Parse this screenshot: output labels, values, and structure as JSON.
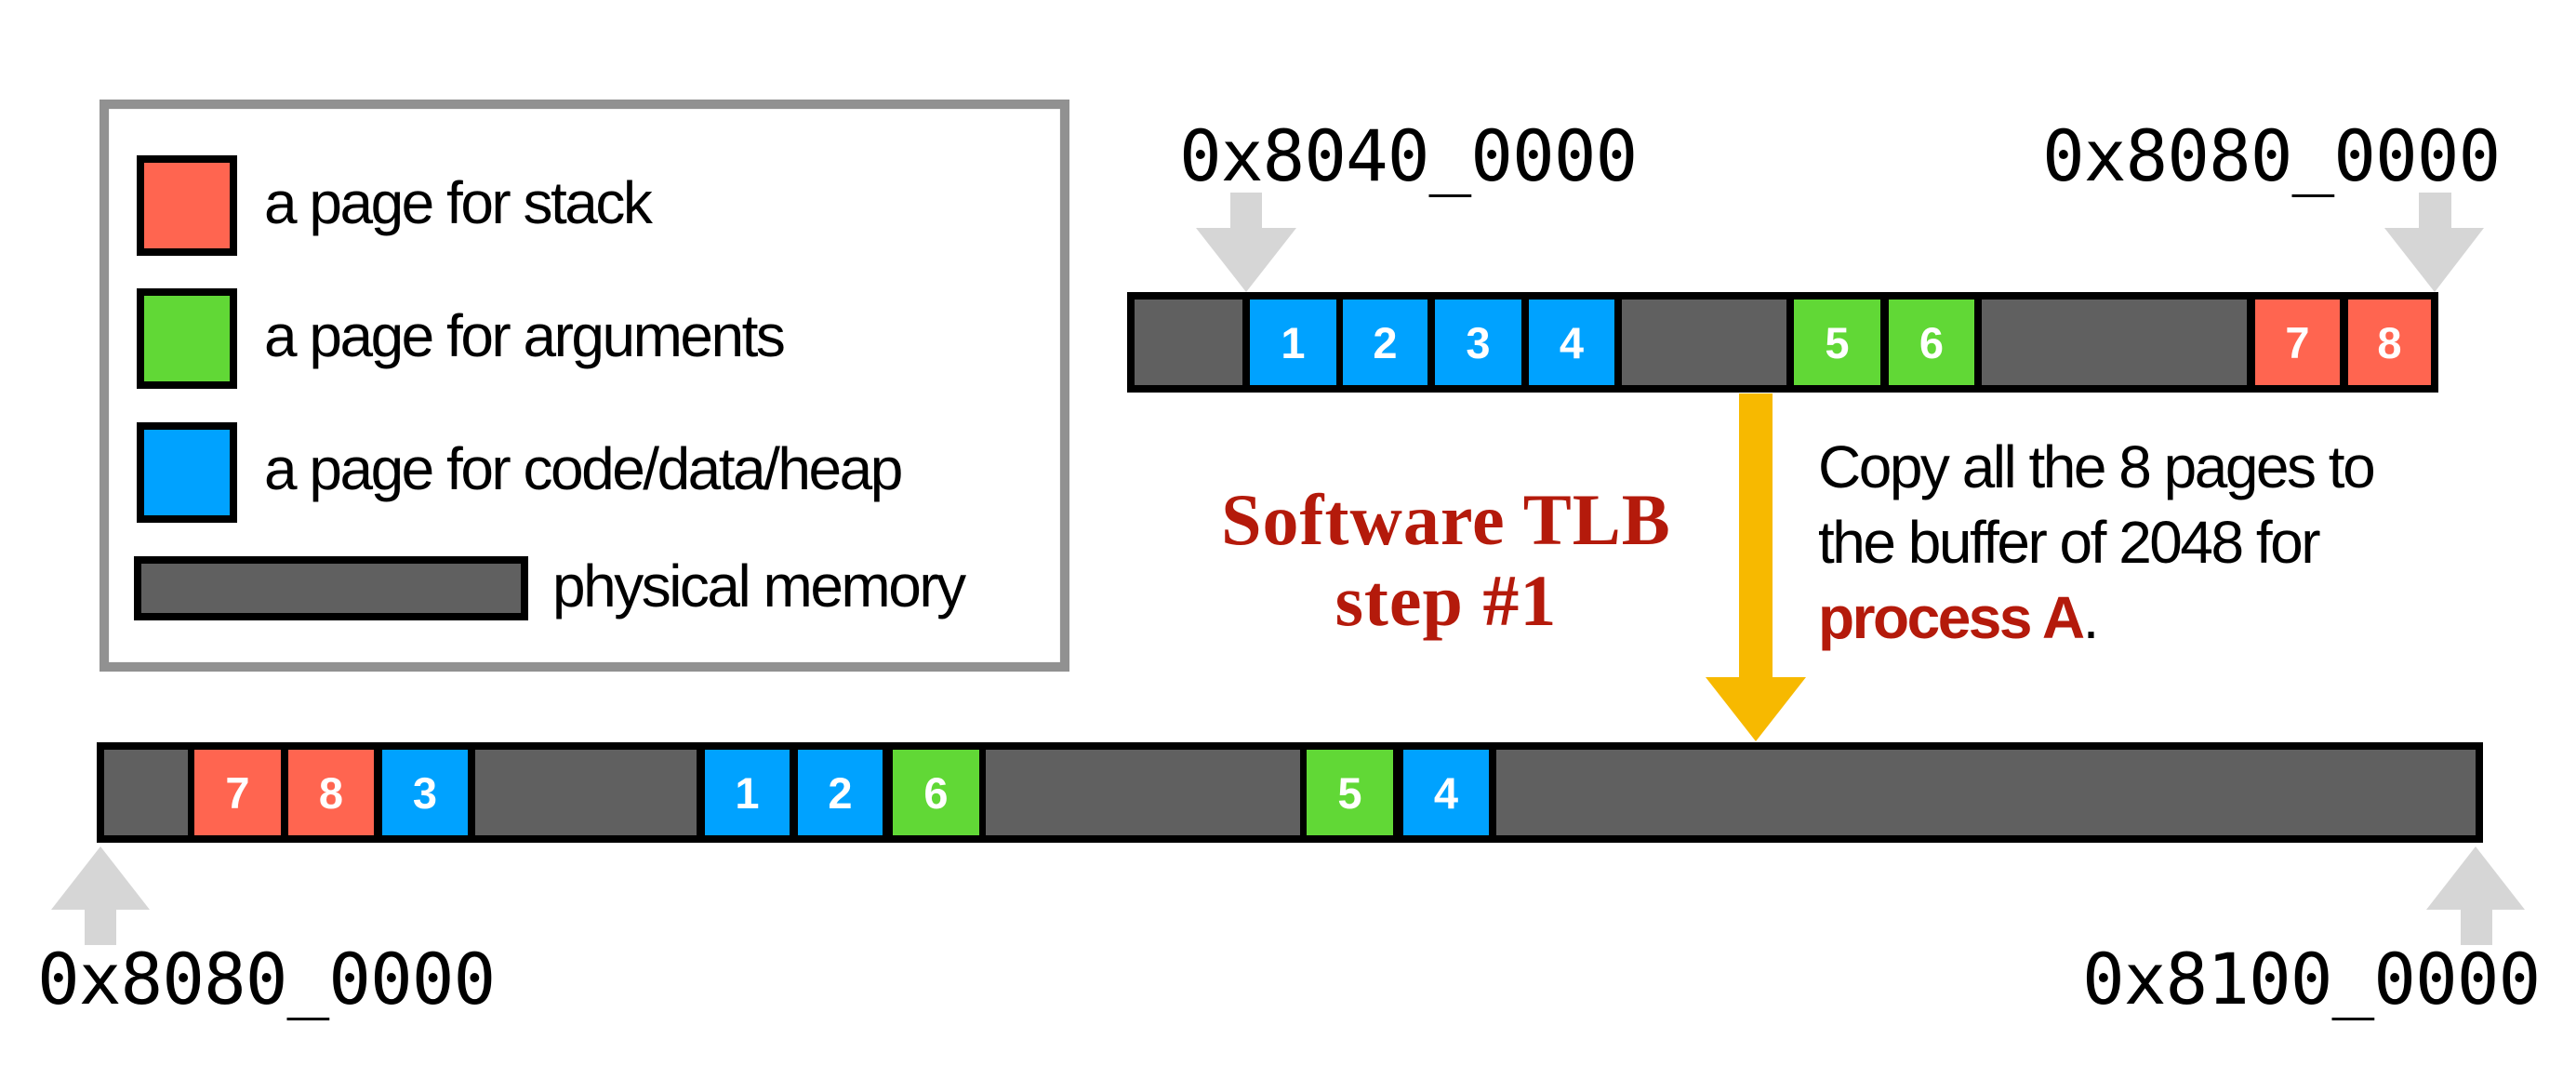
{
  "legend": {
    "items": [
      {
        "label": "a page for stack",
        "kind": "stack",
        "color": "#ff6550"
      },
      {
        "label": "a page for arguments",
        "kind": "arguments",
        "color": "#61d836"
      },
      {
        "label": "a page for code/data/heap",
        "kind": "code",
        "color": "#00a2ff"
      },
      {
        "label": "physical memory",
        "kind": "memory",
        "color": "#606060"
      }
    ]
  },
  "top_region": {
    "start_address": "0x8040_0000",
    "end_address": "0x8080_0000",
    "segments": [
      {
        "type": "gray",
        "label": ""
      },
      {
        "type": "blue",
        "label": "1"
      },
      {
        "type": "blue",
        "label": "2"
      },
      {
        "type": "blue",
        "label": "3"
      },
      {
        "type": "blue",
        "label": "4"
      },
      {
        "type": "gray",
        "label": ""
      },
      {
        "type": "green",
        "label": "5"
      },
      {
        "type": "green",
        "label": "6"
      },
      {
        "type": "gray",
        "label": ""
      },
      {
        "type": "red",
        "label": "7"
      },
      {
        "type": "red",
        "label": "8"
      }
    ]
  },
  "bottom_region": {
    "start_address": "0x8080_0000",
    "end_address": "0x8100_0000",
    "segments": [
      {
        "type": "gray",
        "label": ""
      },
      {
        "type": "red",
        "label": "7"
      },
      {
        "type": "red",
        "label": "8"
      },
      {
        "type": "blue",
        "label": "3"
      },
      {
        "type": "gray",
        "label": ""
      },
      {
        "type": "blue",
        "label": "1"
      },
      {
        "type": "blue",
        "label": "2"
      },
      {
        "type": "green",
        "label": "6"
      },
      {
        "type": "gray",
        "label": ""
      },
      {
        "type": "green",
        "label": "5"
      },
      {
        "type": "blue",
        "label": "4"
      },
      {
        "type": "gray",
        "label": ""
      }
    ]
  },
  "step_title": {
    "line1": "Software TLB",
    "line2": "step #1"
  },
  "description": {
    "line1": "Copy all the 8 pages to",
    "line2": "the buffer of 2048 for",
    "highlight": "process A",
    "suffix": "."
  },
  "colors": {
    "stack": "#ff6550",
    "arguments": "#61d836",
    "code": "#00a2ff",
    "memory": "#606060",
    "copy_arrow": "#f7b900",
    "address_arrow": "#d6d6d6",
    "accent_text": "#b41a0b"
  }
}
